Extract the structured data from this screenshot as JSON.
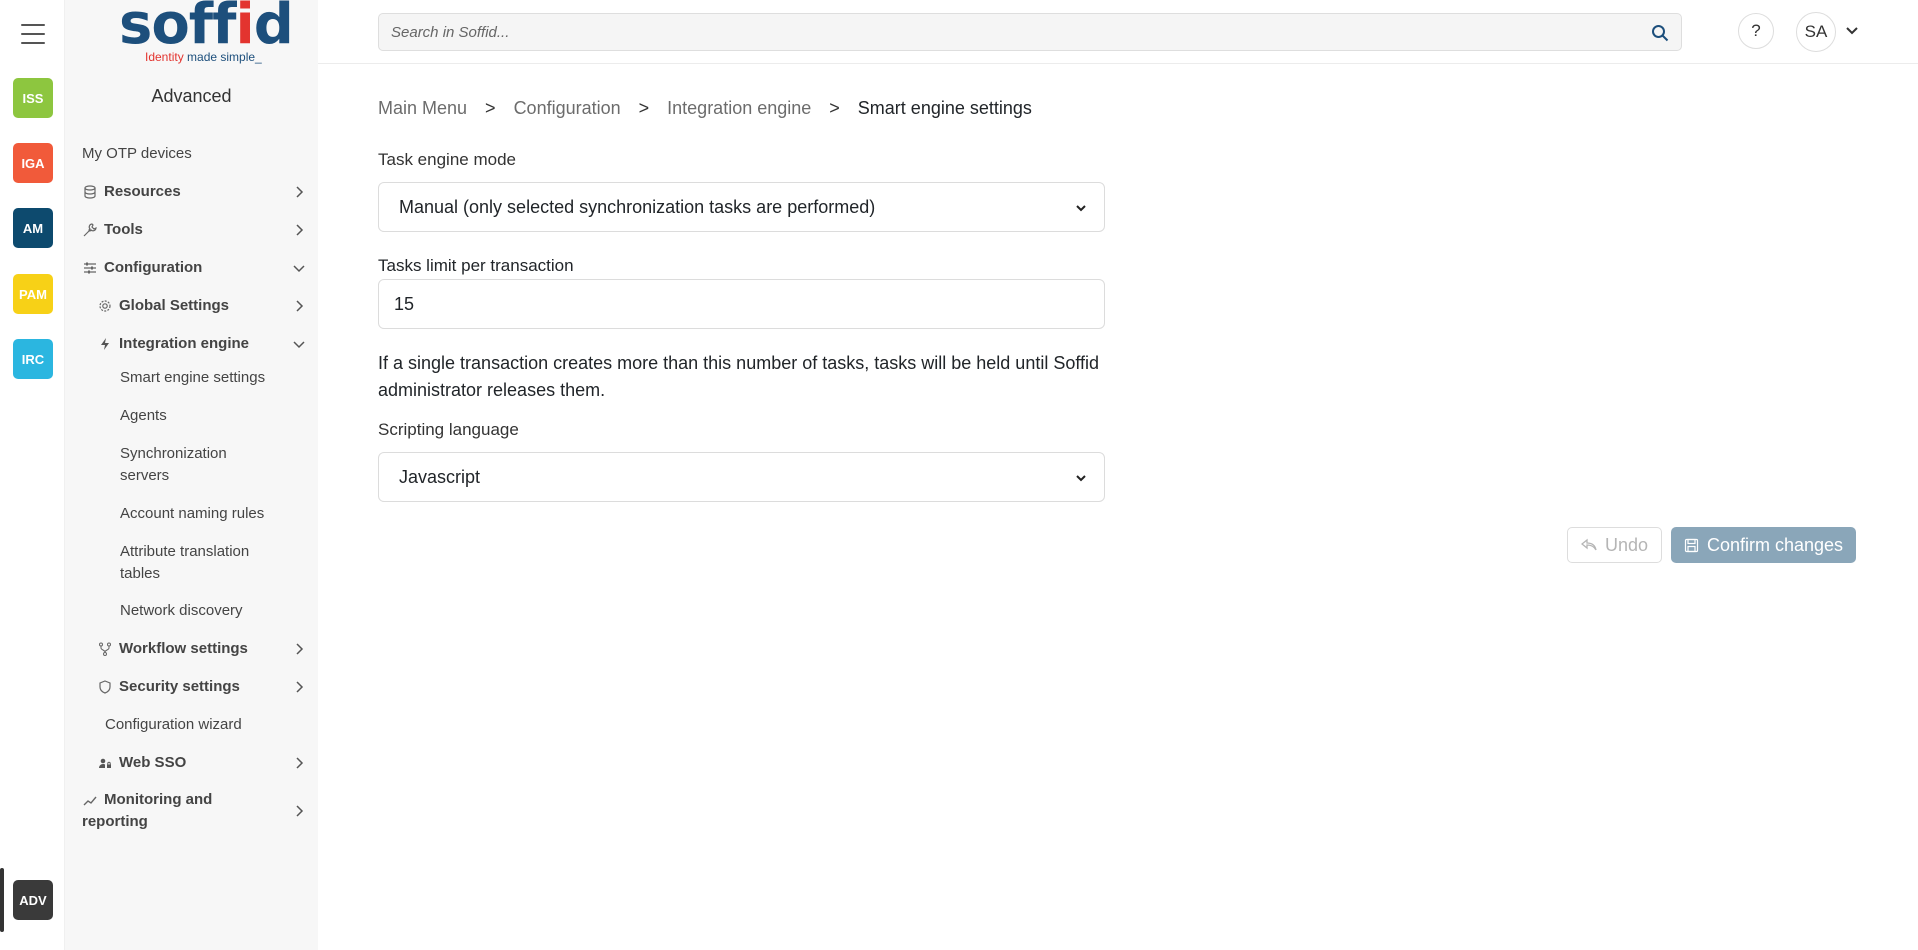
{
  "rail": {
    "modules": [
      {
        "label": "ISS",
        "color": "#8dc63f"
      },
      {
        "label": "IGA",
        "color": "#f15a3a"
      },
      {
        "label": "AM",
        "color": "#0d4a6e"
      },
      {
        "label": "PAM",
        "color": "#f7d117"
      },
      {
        "label": "IRC",
        "color": "#2bb6e0"
      },
      {
        "label": "ADV",
        "color": "#3a3a3a"
      }
    ]
  },
  "logo": {
    "word_a": "soff",
    "word_dot": "i",
    "word_b": "d",
    "tag_a": "Identity ",
    "tag_b": "made simple_"
  },
  "sidebar": {
    "title": "Advanced",
    "items": {
      "otp": "My OTP devices",
      "resources": "Resources",
      "tools": "Tools",
      "configuration": "Configuration",
      "global_settings": "Global Settings",
      "integration_engine": "Integration engine",
      "smart_engine": "Smart engine settings",
      "agents": "Agents",
      "sync_servers_1": "Synchronization",
      "sync_servers_2": "servers",
      "account_naming": "Account naming rules",
      "attr_tables_1": "Attribute translation",
      "attr_tables_2": "tables",
      "network_discovery": "Network discovery",
      "workflow": "Workflow settings",
      "security": "Security settings",
      "wizard": "Configuration wizard",
      "websso": "Web SSO",
      "monitoring_1": "Monitoring and",
      "monitoring_2": "reporting"
    }
  },
  "topbar": {
    "search_placeholder": "Search in Soffid...",
    "help": "?",
    "avatar": "SA"
  },
  "breadcrumb": {
    "items": [
      "Main Menu",
      "Configuration",
      "Integration engine"
    ],
    "current": "Smart engine settings",
    "separator": ">"
  },
  "form": {
    "task_mode_label": "Task engine mode",
    "task_mode_value": "Manual (only selected synchronization tasks are performed)",
    "tasks_limit_label": "Tasks limit per transaction",
    "tasks_limit_value": "15",
    "help_text": "If a single transaction creates more than this number of tasks, tasks will be held until Soffid administrator releases them.",
    "scripting_label": "Scripting language",
    "scripting_value": "Javascript"
  },
  "actions": {
    "undo": "Undo",
    "confirm": "Confirm changes"
  }
}
